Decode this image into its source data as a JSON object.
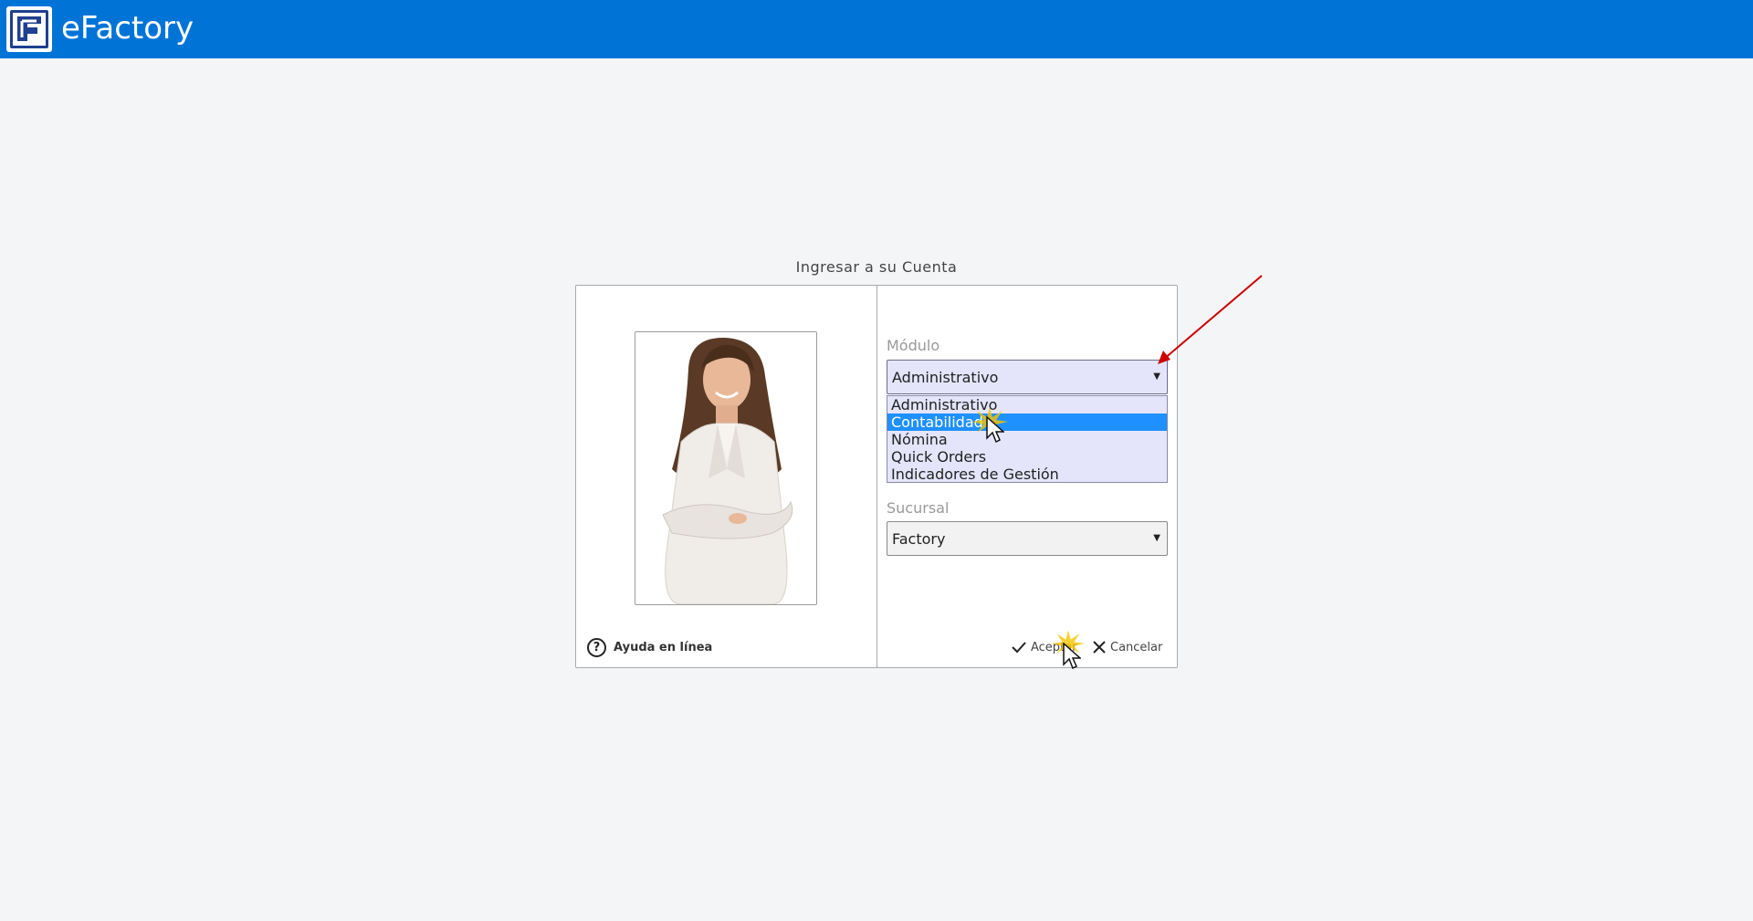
{
  "app": {
    "title": "eFactory",
    "brand_color": "#0074d6"
  },
  "dialog": {
    "title": "Ingresar a su Cuenta",
    "help_label": "Ayuda en línea",
    "help_icon": "question-circle-icon",
    "modulo": {
      "label": "Módulo",
      "selected": "Administrativo",
      "options": [
        "Administrativo",
        "Contabilidad",
        "Nómina",
        "Quick Orders",
        "Indicadores de Gestión"
      ],
      "highlighted": "Contabilidad"
    },
    "sucursal": {
      "label": "Sucursal",
      "selected": "Factory"
    },
    "accept_label": "Aceptar",
    "cancel_label": "Cancelar"
  },
  "colors": {
    "highlight": "#1e90ff",
    "dropdown_bg": "#e4e5fb",
    "annotation_arrow": "#cc0000"
  }
}
